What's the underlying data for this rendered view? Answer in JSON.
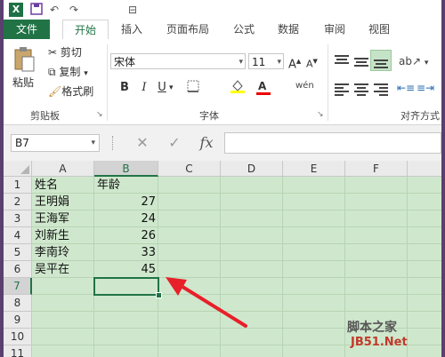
{
  "app": {
    "logo_letter": "X",
    "brand_color": "#217346"
  },
  "qat": {
    "undo": "↶",
    "redo": "↷",
    "extra": "⊟"
  },
  "tabs": [
    {
      "label": "文件"
    },
    {
      "label": "开始"
    },
    {
      "label": "插入"
    },
    {
      "label": "页面布局"
    },
    {
      "label": "公式"
    },
    {
      "label": "数据"
    },
    {
      "label": "审阅"
    },
    {
      "label": "视图"
    }
  ],
  "ribbon": {
    "clipboard": {
      "paste": "粘贴",
      "cut": "剪切",
      "copy": "复制",
      "format_painter": "格式刷",
      "group_label": "剪贴板"
    },
    "font": {
      "font_name": "宋体",
      "font_size": "11",
      "bold": "B",
      "italic": "I",
      "underline": "U",
      "phonetic": "wén",
      "group_label": "字体"
    },
    "alignment": {
      "group_label": "对齐方式"
    }
  },
  "formula_bar": {
    "name_box": "B7",
    "cancel": "✕",
    "enter": "✓",
    "fx": "fx",
    "formula": ""
  },
  "sheet": {
    "columns": [
      "A",
      "B",
      "C",
      "D",
      "E",
      "F"
    ],
    "rows": [
      "1",
      "2",
      "3",
      "4",
      "5",
      "6",
      "7",
      "8",
      "9",
      "10",
      "11"
    ],
    "selected_cell": "B7",
    "header": [
      "姓名",
      "年龄"
    ],
    "data": [
      {
        "name": "王明娟",
        "age": "27"
      },
      {
        "name": "王海军",
        "age": "24"
      },
      {
        "name": "刘新生",
        "age": "26"
      },
      {
        "name": "李南玲",
        "age": "33"
      },
      {
        "name": "吴平在",
        "age": "45"
      }
    ]
  },
  "watermark": {
    "line1": "脚本之家",
    "line2": "JB51.Net"
  }
}
